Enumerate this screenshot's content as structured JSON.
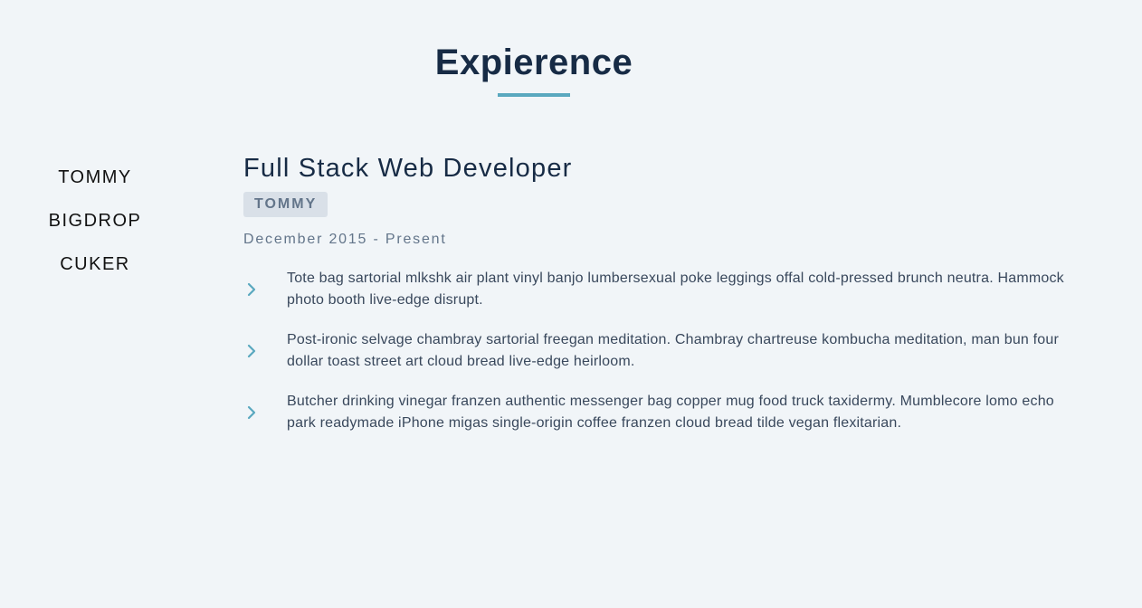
{
  "section": {
    "title": "Expierence"
  },
  "companies": [
    {
      "label": "TOMMY"
    },
    {
      "label": "BIGDROP"
    },
    {
      "label": "CUKER"
    }
  ],
  "job": {
    "title": "Full Stack Web Developer",
    "company": "TOMMY",
    "date_range": "December 2015 - Present",
    "duties": [
      {
        "text": "Tote bag sartorial mlkshk air plant vinyl banjo lumbersexual poke leggings offal cold-pressed brunch neutra. Hammock photo booth live-edge disrupt."
      },
      {
        "text": "Post-ironic selvage chambray sartorial freegan meditation. Chambray chartreuse kombucha meditation, man bun four dollar toast street art cloud bread live-edge heirloom."
      },
      {
        "text": "Butcher drinking vinegar franzen authentic messenger bag copper mug food truck taxidermy. Mumblecore lomo echo park readymade iPhone migas single-origin coffee franzen cloud bread tilde vegan flexitarian."
      }
    ]
  },
  "icons": {
    "duty_bullet": "chevron-right-icon"
  },
  "colors": {
    "background": "#f1f5f8",
    "accent": "#5aa8bf",
    "heading": "#172b45",
    "muted": "#63758a",
    "badge_background": "#d9e0e8",
    "body_text": "#39485c"
  }
}
